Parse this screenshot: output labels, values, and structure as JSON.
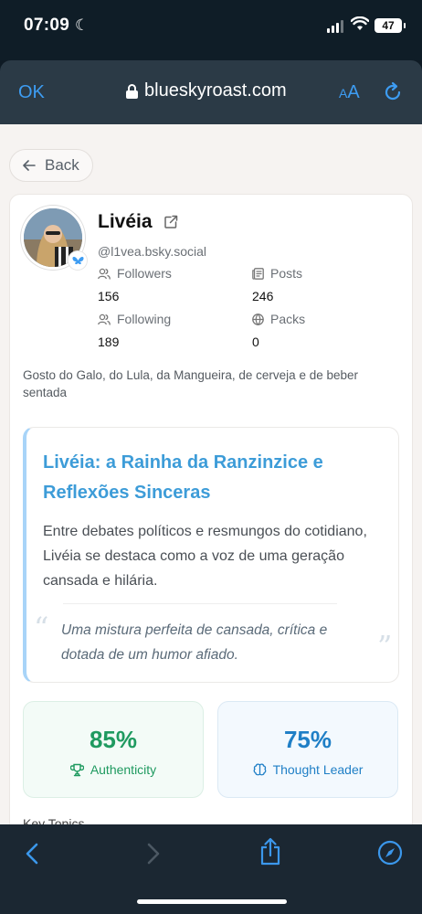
{
  "status_bar": {
    "time": "07:09",
    "battery": "47"
  },
  "browser": {
    "ok_label": "OK",
    "url": "blueskyroast.com",
    "text_size_small": "A",
    "text_size_large": "A"
  },
  "nav": {
    "back_label": "Back"
  },
  "profile": {
    "name": "Livéia",
    "handle": "@l1vea.bsky.social",
    "stats": [
      {
        "label": "Followers",
        "value": "156",
        "icon": "users-icon"
      },
      {
        "label": "Posts",
        "value": "246",
        "icon": "posts-icon"
      },
      {
        "label": "Following",
        "value": "189",
        "icon": "users-icon"
      },
      {
        "label": "Packs",
        "value": "0",
        "icon": "globe-icon"
      }
    ],
    "bio": "Gosto do Galo, do Lula, da Mangueira, de cerveja e de beber sentada"
  },
  "roast": {
    "title": "Livéia: a Rainha da Ranzinzice e Reflexões Sinceras",
    "text": "Entre debates políticos e resmungos do cotidiano, Livéia se destaca como a voz de uma geração cansada e hilária.",
    "quote": "Uma mistura perfeita de cansada, crítica e dotada de um humor afiado.",
    "quote_open": "“",
    "quote_close": "”"
  },
  "metrics": [
    {
      "value": "85%",
      "label": "Authenticity",
      "icon": "trophy-icon",
      "color": "#1f9a60"
    },
    {
      "value": "75%",
      "label": "Thought Leader",
      "icon": "brain-icon",
      "color": "#1f7fc6"
    }
  ],
  "sections": {
    "key_topics": "Key Topics"
  },
  "colors": {
    "accent": "#3d9cf2",
    "roast_title": "#3d9cd8"
  }
}
